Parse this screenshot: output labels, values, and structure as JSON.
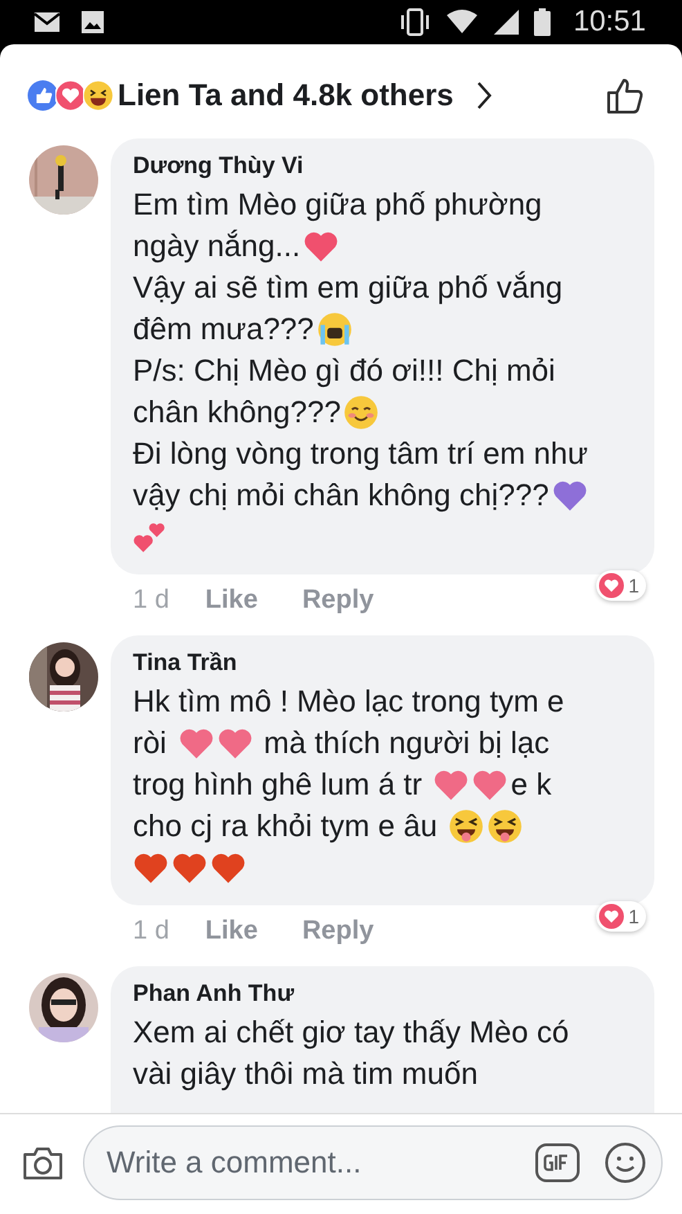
{
  "status_bar": {
    "time": "10:51"
  },
  "reactions_summary": {
    "text": "Lien Ta and 4.8k others"
  },
  "comments": [
    {
      "author": "Dương Thùy Vi",
      "time": "1 d",
      "like": "Like",
      "reply": "Reply",
      "reaction_count": "1",
      "lines": [
        [
          {
            "kind": "text",
            "text": "Em tìm Mèo giữa phố phường"
          }
        ],
        [
          {
            "kind": "text",
            "text": "ngày nắng..."
          },
          {
            "kind": "heart",
            "color": "#f0506e"
          }
        ],
        [
          {
            "kind": "text",
            "text": "Vậy ai sẽ tìm em giữa phố vắng"
          }
        ],
        [
          {
            "kind": "text",
            "text": "đêm mưa???"
          },
          {
            "kind": "crying-face"
          }
        ],
        [
          {
            "kind": "text",
            "text": "P/s: Chị Mèo gì đó ơi!!! Chị mỏi"
          }
        ],
        [
          {
            "kind": "text",
            "text": "chân không???"
          },
          {
            "kind": "smiling-face"
          }
        ],
        [
          {
            "kind": "text",
            "text": "Đi lòng vòng trong tâm trí em như"
          }
        ],
        [
          {
            "kind": "text",
            "text": "vậy chị mỏi chân không chị???"
          },
          {
            "kind": "heart",
            "color": "#8e6fd8"
          }
        ],
        [
          {
            "kind": "two-hearts"
          }
        ]
      ]
    },
    {
      "author": "Tina Trần",
      "time": "1 d",
      "like": "Like",
      "reply": "Reply",
      "reaction_count": "1",
      "lines": [
        [
          {
            "kind": "text",
            "text": "Hk tìm mô ! Mèo lạc trong tym e"
          }
        ],
        [
          {
            "kind": "text",
            "text": "ròi "
          },
          {
            "kind": "heart",
            "color": "#f06a86"
          },
          {
            "kind": "heart",
            "color": "#f06a86"
          },
          {
            "kind": "text",
            "text": " mà thích người bị lạc"
          }
        ],
        [
          {
            "kind": "text",
            "text": "trog hình ghê lum á tr "
          },
          {
            "kind": "heart",
            "color": "#f06a86"
          },
          {
            "kind": "heart",
            "color": "#f06a86"
          },
          {
            "kind": "text",
            "text": "e k"
          }
        ],
        [
          {
            "kind": "text",
            "text": "cho cj ra khỏi tym e âu "
          },
          {
            "kind": "squint-tongue-face"
          },
          {
            "kind": "squint-tongue-face"
          }
        ],
        [
          {
            "kind": "heart",
            "color": "#e0421f"
          },
          {
            "kind": "heart",
            "color": "#e0421f"
          },
          {
            "kind": "heart",
            "color": "#e0421f"
          }
        ]
      ]
    },
    {
      "author": "Phan Anh Thư",
      "lines": [
        [
          {
            "kind": "text",
            "text": "Xem ai chết giơ tay thấy Mèo có"
          }
        ],
        [
          {
            "kind": "text",
            "text": "vài giây thôi mà tim muốn"
          }
        ]
      ]
    }
  ],
  "composer": {
    "placeholder": "Write a comment..."
  }
}
